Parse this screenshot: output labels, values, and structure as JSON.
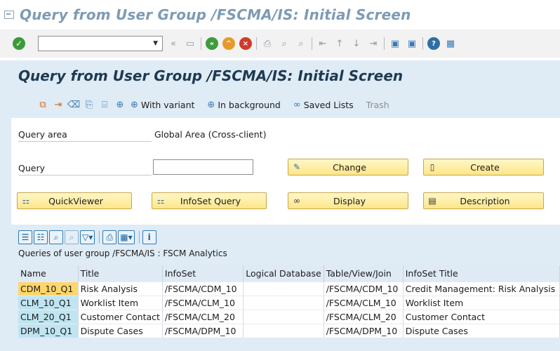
{
  "window": {
    "title": "Query from User Group /FSCMA/IS: Initial Screen"
  },
  "system_toolbar": {
    "command_field": {
      "value": "",
      "placeholder": ""
    }
  },
  "screen": {
    "title": "Query from User Group /FSCMA/IS: Initial Screen",
    "app_toolbar": {
      "with_variant_label": "With variant",
      "in_background_label": "In background",
      "saved_lists_label": "Saved Lists",
      "trash_label": "Trash"
    }
  },
  "form": {
    "query_area_label": "Query area",
    "query_area_value": "Global Area (Cross-client)",
    "query_label": "Query",
    "query_value": "",
    "buttons": {
      "change": "Change",
      "create": "Create",
      "quickviewer": "QuickViewer",
      "infoset_query": "InfoSet Query",
      "display": "Display",
      "description": "Description"
    }
  },
  "grid": {
    "title": "Queries of user group /FSCMA/IS : FSCM Analytics",
    "columns": [
      "Name",
      "Title",
      "InfoSet",
      "Logical Database",
      "Table/View/Join",
      "InfoSet Title"
    ],
    "rows": [
      [
        "CDM_10_Q1",
        "Risk Analysis",
        "/FSCMA/CDM_10",
        "",
        "/FSCMA/CDM_10",
        "Credit  Management: Risk Analysis"
      ],
      [
        "CLM_10_Q1",
        "Worklist Item",
        "/FSCMA/CLM_10",
        "",
        "/FSCMA/CLM_10",
        "Worklist Item"
      ],
      [
        "CLM_20_Q1",
        "Customer Contact",
        "/FSCMA/CLM_20",
        "",
        "/FSCMA/CLM_20",
        "Customer Contact"
      ],
      [
        "DPM_10_Q1",
        "Dispute Cases",
        "/FSCMA/DPM_10",
        "",
        "/FSCMA/DPM_10",
        "Dispute Cases"
      ]
    ]
  }
}
